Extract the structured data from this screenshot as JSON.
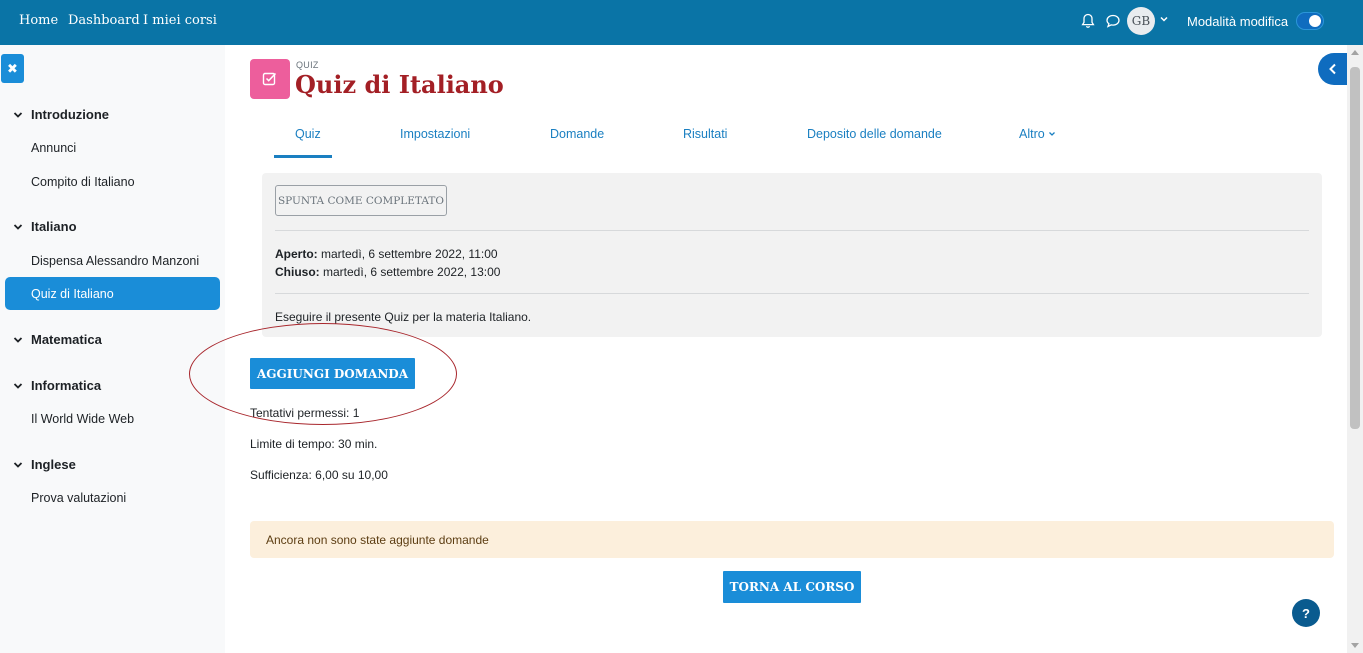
{
  "navbar": {
    "links": [
      "Home",
      "Dashboard",
      "I miei corsi"
    ],
    "avatar_initials": "GB",
    "edit_mode_label": "Modalità modifica",
    "edit_mode_on": true,
    "icons": [
      "bell-icon",
      "chat-icon",
      "chevron-down-icon"
    ]
  },
  "sidebar": {
    "sections": [
      {
        "title": "Introduzione",
        "items": [
          "Annunci",
          "Compito di Italiano"
        ]
      },
      {
        "title": "Italiano",
        "items": [
          "Dispensa Alessandro Manzoni",
          "Quiz di Italiano"
        ]
      },
      {
        "title": "Matematica",
        "items": []
      },
      {
        "title": "Informatica",
        "items": [
          "Il World Wide Web"
        ]
      },
      {
        "title": "Inglese",
        "items": [
          "Prova valutazioni"
        ]
      }
    ],
    "active_item": "Quiz di Italiano"
  },
  "header": {
    "kicker": "QUIZ",
    "title": "Quiz di Italiano"
  },
  "tabs": [
    {
      "label": "Quiz",
      "active": true
    },
    {
      "label": "Impostazioni"
    },
    {
      "label": "Domande"
    },
    {
      "label": "Risultati"
    },
    {
      "label": "Deposito delle domande"
    },
    {
      "label": "Altro"
    }
  ],
  "activity": {
    "complete_button": "SPUNTA COME COMPLETATO",
    "opened_label": "Aperto:",
    "opened_value": " martedì, 6 settembre 2022, 11:00",
    "closed_label": "Chiuso:",
    "closed_value": " martedì, 6 settembre 2022, 13:00",
    "description": "Eseguire il presente Quiz per la materia Italiano."
  },
  "main": {
    "add_question_button": "AGGIUNGI DOMANDA",
    "attempts": "Tentativi permessi: 1",
    "time_limit": "Limite di tempo: 30 min.",
    "passing_grade": "Sufficienza: 6,00 su 10,00",
    "alert": "Ancora non sono state aggiunte domande",
    "back_button": "TORNA AL CORSO",
    "help_label": "?"
  },
  "colors": {
    "navbar": "#0a74a6",
    "primary": "#1a8dd8",
    "title": "#a31f25",
    "quiz_icon": "#ed5e9c",
    "alert_bg": "#fcefdc",
    "annotation": "#a8262c"
  }
}
